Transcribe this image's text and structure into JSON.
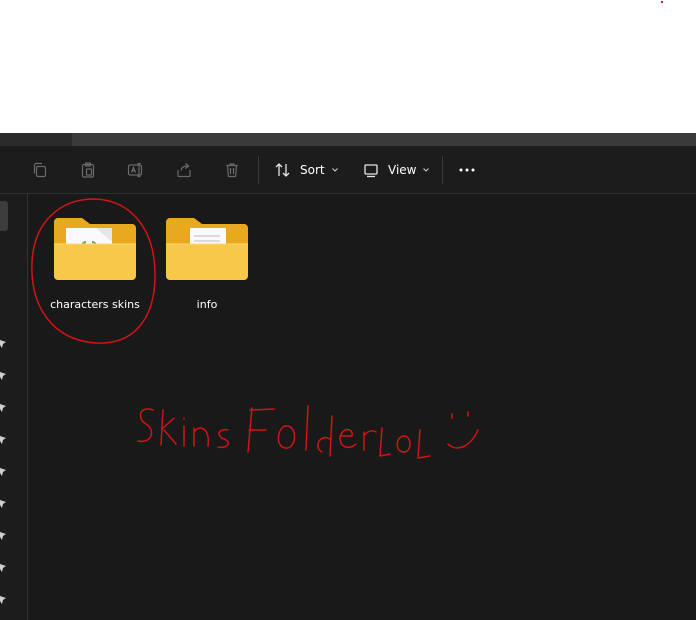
{
  "toolbar": {
    "icons": [
      "copy-icon",
      "paste-icon",
      "rename-icon",
      "share-icon",
      "delete-icon"
    ],
    "sort_label": "Sort",
    "view_label": "View"
  },
  "folders": [
    {
      "name": "characters skins"
    },
    {
      "name": "info"
    }
  ],
  "colors": {
    "background": "#191919",
    "toolbar": "#1c1c1c",
    "folder": "#f5c342",
    "annotation": "#d21414"
  }
}
